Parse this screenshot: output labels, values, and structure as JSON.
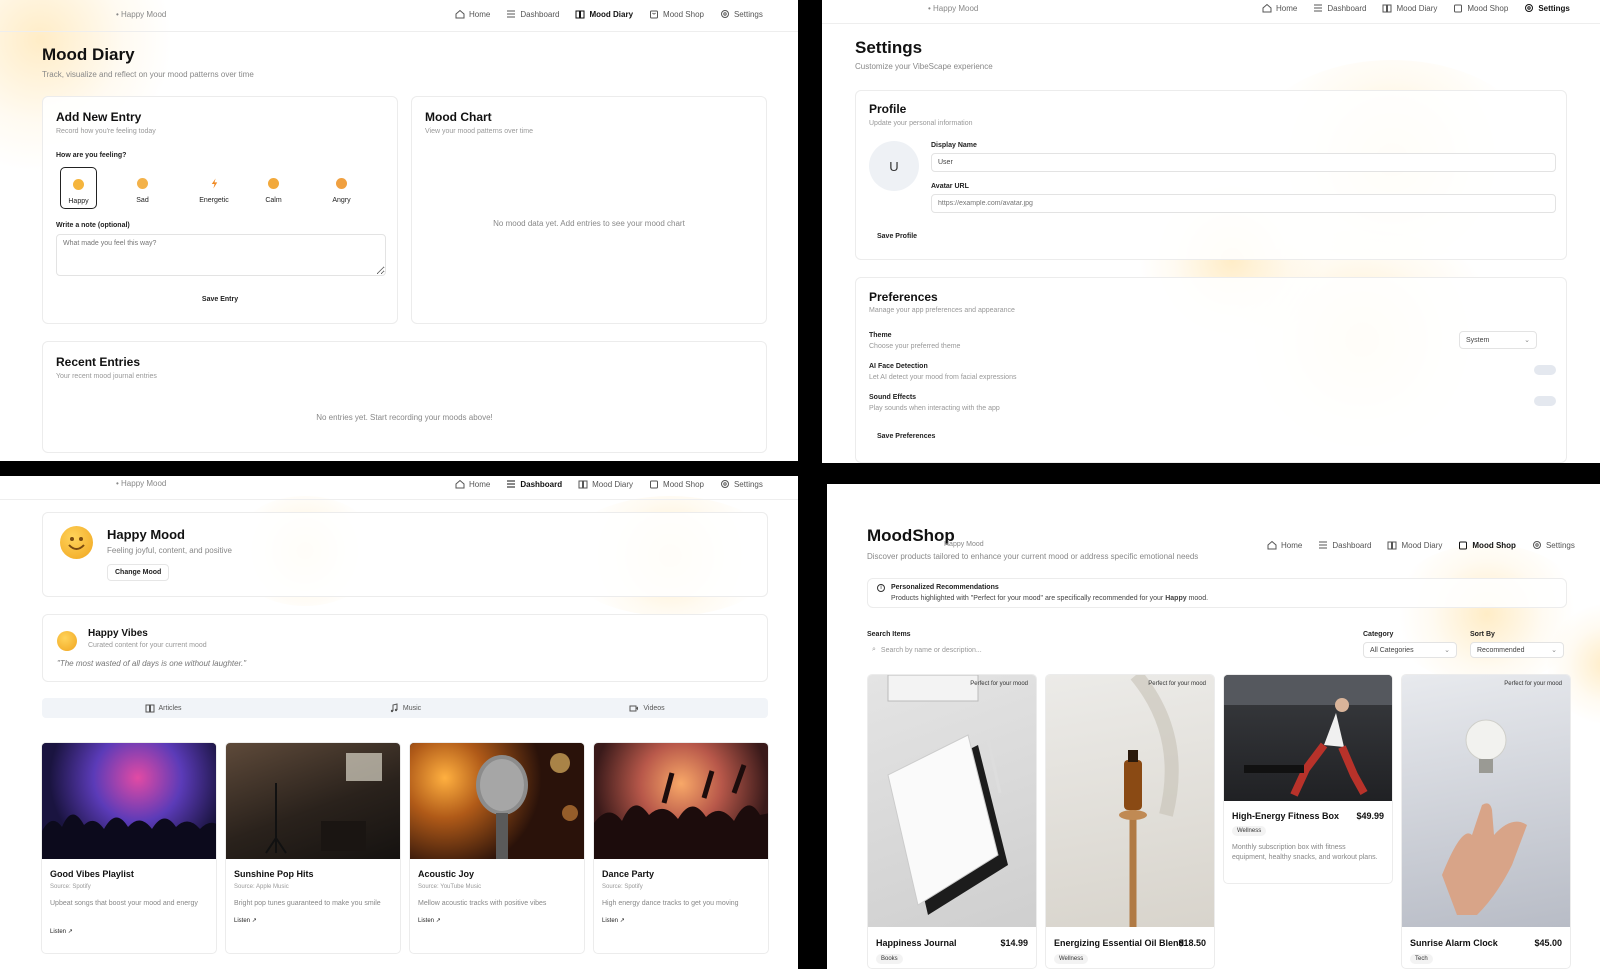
{
  "nav": {
    "brand": "• Happy Mood",
    "items": [
      {
        "label": "Home",
        "icon": "home-icon"
      },
      {
        "label": "Dashboard",
        "icon": "menu-icon"
      },
      {
        "label": "Mood Diary",
        "icon": "book-icon"
      },
      {
        "label": "Mood Shop",
        "icon": "shopping-bag-icon"
      },
      {
        "label": "Settings",
        "icon": "gear-icon"
      }
    ]
  },
  "diary": {
    "title": "Mood Diary",
    "subtitle": "Track, visualize and reflect on your mood patterns over time",
    "add_entry": {
      "title": "Add New Entry",
      "subtitle": "Record how you're feeling today",
      "question": "How are you feeling?",
      "moods": [
        "Happy",
        "Sad",
        "Energetic",
        "Calm",
        "Angry"
      ],
      "selected": "Happy",
      "note_label": "Write a note (optional)",
      "note_placeholder": "What made you feel this way?",
      "save_label": "Save Entry"
    },
    "chart": {
      "title": "Mood Chart",
      "subtitle": "View your mood patterns over time",
      "empty": "No mood data yet. Add entries to see your mood chart"
    },
    "recent": {
      "title": "Recent Entries",
      "subtitle": "Your recent mood journal entries",
      "empty": "No entries yet. Start recording your moods above!"
    }
  },
  "settings": {
    "title": "Settings",
    "subtitle": "Customize your VibeScape experience",
    "profile": {
      "title": "Profile",
      "subtitle": "Update your personal information",
      "avatar_initial": "U",
      "display_name_label": "Display Name",
      "display_name_value": "User",
      "avatar_url_label": "Avatar URL",
      "avatar_url_placeholder": "https://example.com/avatar.jpg",
      "save_label": "Save Profile"
    },
    "preferences": {
      "title": "Preferences",
      "subtitle": "Manage your app preferences and appearance",
      "theme_label": "Theme",
      "theme_desc": "Choose your preferred theme",
      "theme_value": "System",
      "face_label": "AI Face Detection",
      "face_desc": "Let AI detect your mood from facial expressions",
      "sound_label": "Sound Effects",
      "sound_desc": "Play sounds when interacting with the app",
      "save_label": "Save Preferences"
    }
  },
  "dashboard": {
    "mood_title": "Happy Mood",
    "mood_desc": "Feeling joyful, content, and positive",
    "change_label": "Change Mood",
    "vibes_title": "Happy Vibes",
    "vibes_sub": "Curated content for your current mood",
    "quote": "\"The most wasted of all days is one without laughter.\"",
    "tabs": [
      "Articles",
      "Music",
      "Videos"
    ],
    "cards": [
      {
        "title": "Good Vibes Playlist",
        "source": "Source: Spotify",
        "desc": "Upbeat songs that boost your mood and energy",
        "link": "Listen"
      },
      {
        "title": "Sunshine Pop Hits",
        "source": "Source: Apple Music",
        "desc": "Bright pop tunes guaranteed to make you smile",
        "link": "Listen"
      },
      {
        "title": "Acoustic Joy",
        "source": "Source: YouTube Music",
        "desc": "Mellow acoustic tracks with positive vibes",
        "link": "Listen"
      },
      {
        "title": "Dance Party",
        "source": "Source: Spotify",
        "desc": "High energy dance tracks to get you moving",
        "link": "Listen"
      }
    ]
  },
  "shop": {
    "title": "MoodShop",
    "brand_overlay": "Happy Mood",
    "subtitle": "Discover products tailored to enhance your current mood or address specific emotional needs",
    "rec_title": "Personalized Recommendations",
    "rec_prefix": "Products highlighted with \"Perfect for your mood\" are specifically recommended for your",
    "rec_mood": "Happy",
    "rec_suffix": "mood.",
    "search_label": "Search Items",
    "search_placeholder": "Search by name or description...",
    "category_label": "Category",
    "category_value": "All Categories",
    "sort_label": "Sort By",
    "sort_value": "Recommended",
    "badge": "Perfect for your mood",
    "products": [
      {
        "name": "Happiness Journal",
        "price": "$14.99",
        "tag": "Books"
      },
      {
        "name": "Energizing Essential Oil Blend",
        "price": "$18.50",
        "tag": "Wellness"
      },
      {
        "name": "High-Energy Fitness Box",
        "price": "$49.99",
        "tag": "Wellness",
        "desc": "Monthly subscription box with fitness equipment, healthy snacks, and workout plans."
      },
      {
        "name": "Sunrise Alarm Clock",
        "price": "$45.00",
        "tag": "Tech"
      }
    ]
  }
}
